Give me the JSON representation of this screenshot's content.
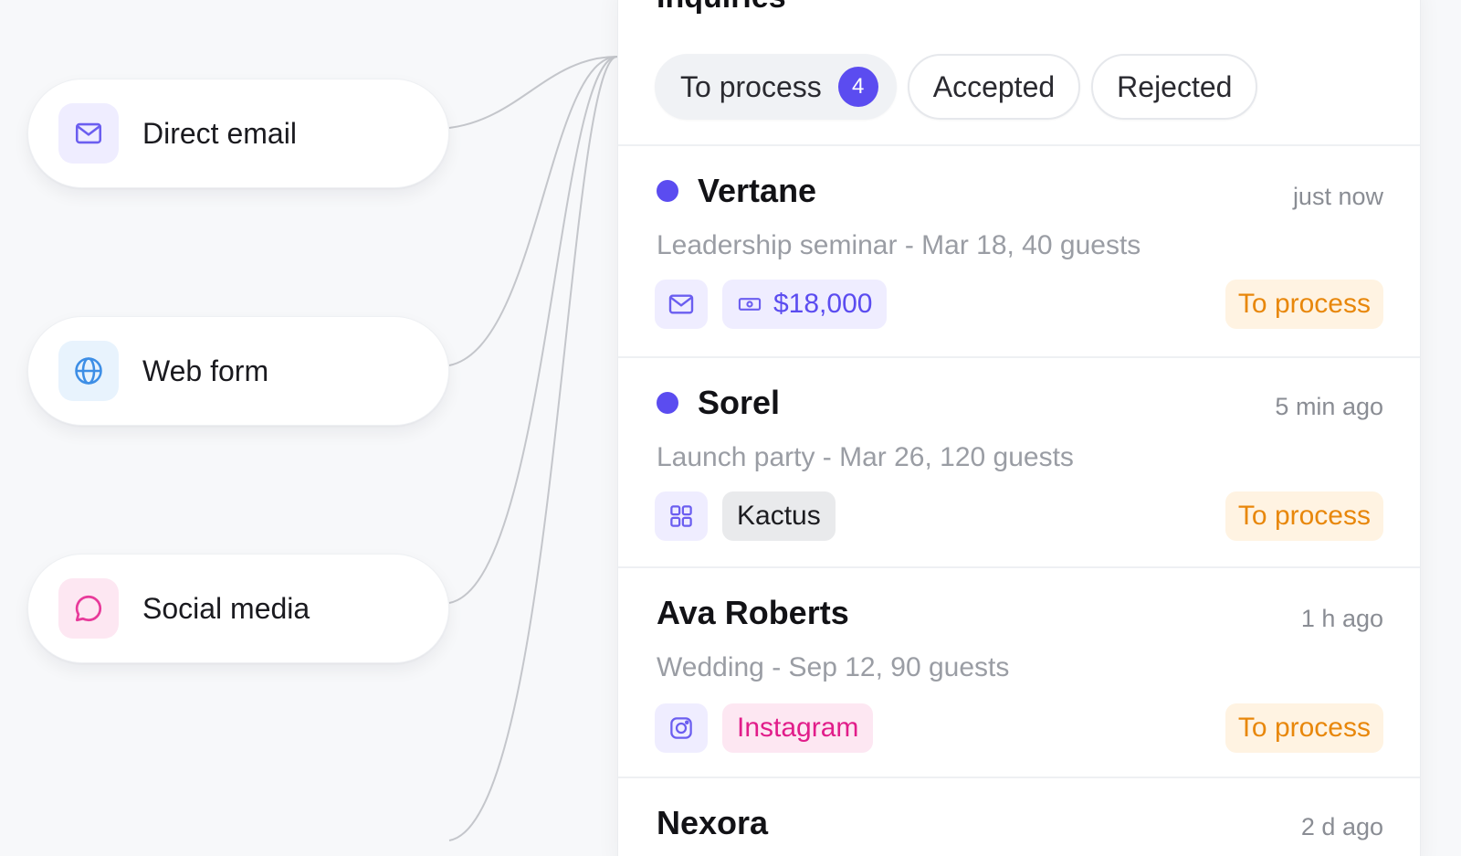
{
  "sources": [
    {
      "label": "Direct email",
      "icon": "mail-icon",
      "color": "#6b5ef0",
      "bg": "#efedff"
    },
    {
      "label": "Web form",
      "icon": "globe-icon",
      "color": "#3d8ee6",
      "bg": "#e8f3fd"
    },
    {
      "label": "Social media",
      "icon": "chat-bubble-icon",
      "color": "#e83a9a",
      "bg": "#fde7f2"
    }
  ],
  "panel": {
    "title": "Inquiries",
    "tabs": [
      {
        "label": "To process",
        "count": "4"
      },
      {
        "label": "Accepted"
      },
      {
        "label": "Rejected"
      }
    ]
  },
  "inquiries": [
    {
      "name": "Vertane",
      "time": "just now",
      "description": "Leadership seminar - Mar 18, 40 guests",
      "channel_icon": "mail-icon",
      "tag": "$18,000",
      "tag_icon": "money-icon",
      "status": "To process",
      "unread": true
    },
    {
      "name": "Sorel",
      "time": "5 min ago",
      "description": "Launch party - Mar 26, 120 guests",
      "channel_icon": "grid-icon",
      "tag": "Kactus",
      "status": "To process",
      "unread": true
    },
    {
      "name": "Ava Roberts",
      "time": "1 h ago",
      "description": "Wedding - Sep 12, 90 guests",
      "channel_icon": "instagram-icon",
      "tag": "Instagram",
      "status": "To process",
      "unread": false
    },
    {
      "name": "Nexora",
      "time": "2 d ago"
    }
  ],
  "colors": {
    "accent": "#5b4cf0",
    "status_text": "#e8870b",
    "status_bg": "#fff3e2",
    "instagram_text": "#e11d8a",
    "instagram_bg": "#fde7f2"
  }
}
